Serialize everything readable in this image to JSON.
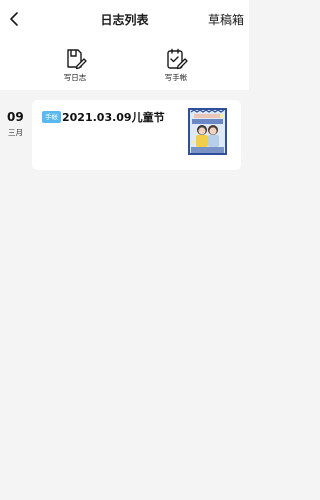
{
  "header": {
    "back_icon": "chevron-left-icon",
    "title": "日志列表",
    "drafts_label": "草稿箱"
  },
  "actions": [
    {
      "label": "写日志",
      "icon": "write-log-icon"
    },
    {
      "label": "写手帐",
      "icon": "write-handbook-icon"
    }
  ],
  "entries": [
    {
      "day": "09",
      "month": "三月",
      "tag": "手帐",
      "title": "2021.03.09儿童节",
      "thumbnail_icon": "handbook-thumbnail-image"
    }
  ],
  "colors": {
    "tag_bg": "#5ab8f0",
    "page_bg": "#f4f4f4",
    "card_bg": "#ffffff"
  }
}
